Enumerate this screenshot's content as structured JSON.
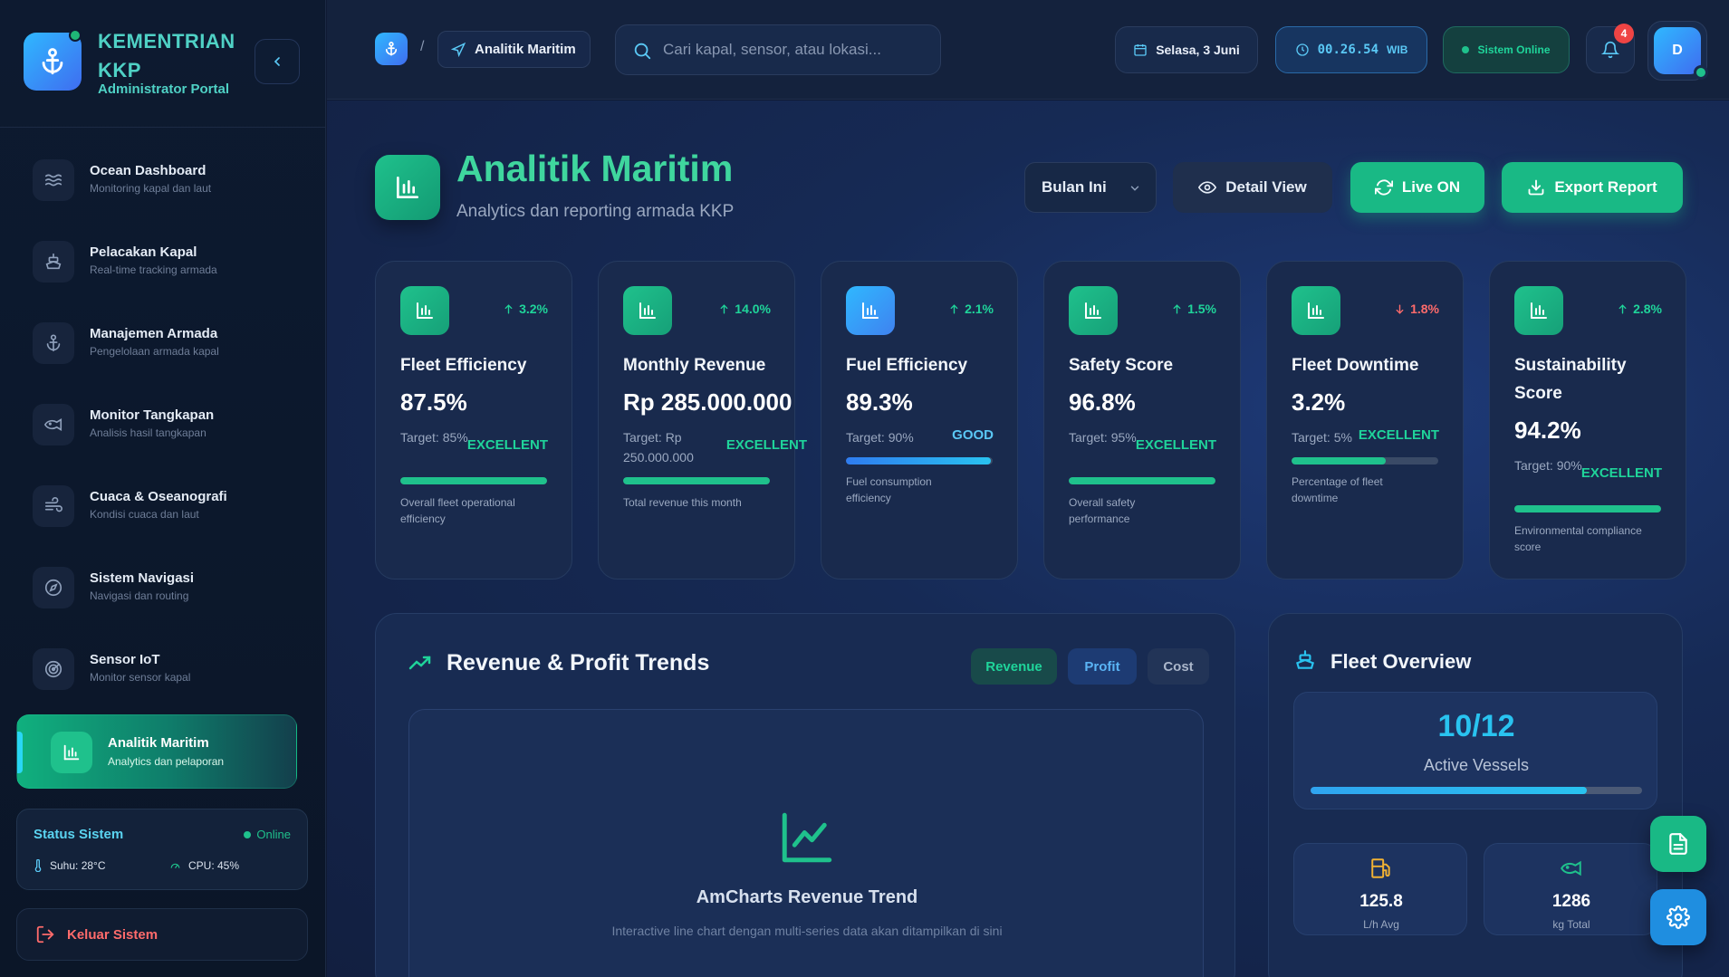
{
  "brand": {
    "title": "KEMENTRIAN KKP",
    "subtitle": "Administrator Portal"
  },
  "sidebar": {
    "items": [
      {
        "label": "Ocean Dashboard",
        "sub": "Monitoring kapal dan laut",
        "icon": "waves-icon"
      },
      {
        "label": "Pelacakan Kapal",
        "sub": "Real-time tracking armada",
        "icon": "ship-icon"
      },
      {
        "label": "Manajemen Armada",
        "sub": "Pengelolaan armada kapal",
        "icon": "anchor-icon"
      },
      {
        "label": "Monitor Tangkapan",
        "sub": "Analisis hasil tangkapan",
        "icon": "fish-icon"
      },
      {
        "label": "Cuaca & Oseanografi",
        "sub": "Kondisi cuaca dan laut",
        "icon": "wind-icon"
      },
      {
        "label": "Sistem Navigasi",
        "sub": "Navigasi dan routing",
        "icon": "compass-icon"
      },
      {
        "label": "Sensor IoT",
        "sub": "Monitor sensor kapal",
        "icon": "radar-icon"
      },
      {
        "label": "Analitik Maritim",
        "sub": "Analytics dan pelaporan",
        "icon": "bar-chart-icon",
        "active": true
      }
    ],
    "status": {
      "title": "Status Sistem",
      "state": "Online",
      "temp": "Suhu: 28°C",
      "cpu": "CPU: 45%"
    },
    "logout": "Keluar Sistem"
  },
  "topbar": {
    "breadcrumb_current": "Analitik Maritim",
    "breadcrumb_sep": "/",
    "search_placeholder": "Cari kapal, sensor, atau lokasi...",
    "date": "Selasa, 3 Juni",
    "time": "00.26.54",
    "time_zone": "WIB",
    "system_status": "Sistem Online",
    "notifications": "4",
    "avatar_initial": "D"
  },
  "page": {
    "title": "Analitik Maritim",
    "subtitle": "Analytics dan reporting armada KKP",
    "period": "Bulan Ini",
    "detail_label": "Detail View",
    "live_label": "Live ON",
    "export_label": "Export Report"
  },
  "kpis": [
    {
      "title": "Fleet Efficiency",
      "value": "87.5%",
      "trend": "3.2%",
      "trend_dir": "up",
      "target": "Target: 85%",
      "grade": "EXCELLENT",
      "progress": 1.0,
      "desc": "Overall fleet operational efficiency",
      "icon_color": "#1fc18c"
    },
    {
      "title": "Monthly Revenue",
      "value": "Rp 285.000.000",
      "trend": "14.0%",
      "trend_dir": "up",
      "target": "Target: Rp 250.000.000",
      "grade": "EXCELLENT",
      "progress": 1.0,
      "desc": "Total revenue this month",
      "icon_color": "#1fc18c"
    },
    {
      "title": "Fuel Efficiency",
      "value": "89.3%",
      "trend": "2.1%",
      "trend_dir": "up",
      "target": "Target: 90%",
      "grade": "GOOD",
      "progress": 0.99,
      "desc": "Fuel consumption efficiency",
      "icon_color": "#2fb8ff"
    },
    {
      "title": "Safety Score",
      "value": "96.8%",
      "trend": "1.5%",
      "trend_dir": "up",
      "target": "Target: 95%",
      "grade": "EXCELLENT",
      "progress": 1.0,
      "desc": "Overall safety performance",
      "icon_color": "#1fc18c"
    },
    {
      "title": "Fleet Downtime",
      "value": "3.2%",
      "trend": "1.8%",
      "trend_dir": "down",
      "target": "Target: 5%",
      "grade": "EXCELLENT",
      "progress": 0.64,
      "desc": "Percentage of fleet downtime",
      "icon_color": "#1fc18c"
    },
    {
      "title": "Sustainability Score",
      "value": "94.2%",
      "trend": "2.8%",
      "trend_dir": "up",
      "target": "Target: 90%",
      "grade": "EXCELLENT",
      "progress": 1.0,
      "desc": "Environmental compliance score",
      "icon_color": "#1fc18c"
    }
  ],
  "revenue_panel": {
    "title": "Revenue & Profit Trends",
    "tabs": [
      "Revenue",
      "Profit",
      "Cost"
    ],
    "placeholder_title": "AmCharts Revenue Trend",
    "placeholder_desc": "Interactive line chart dengan multi-series data akan ditampilkan di sini"
  },
  "fleet_panel": {
    "title": "Fleet Overview",
    "active_count": "10/12",
    "active_label": "Active Vessels",
    "active_fraction": 0.833,
    "fuel_value": "125.8",
    "fuel_unit": "L/h Avg",
    "catch_value": "1286",
    "catch_unit": "kg Total"
  }
}
